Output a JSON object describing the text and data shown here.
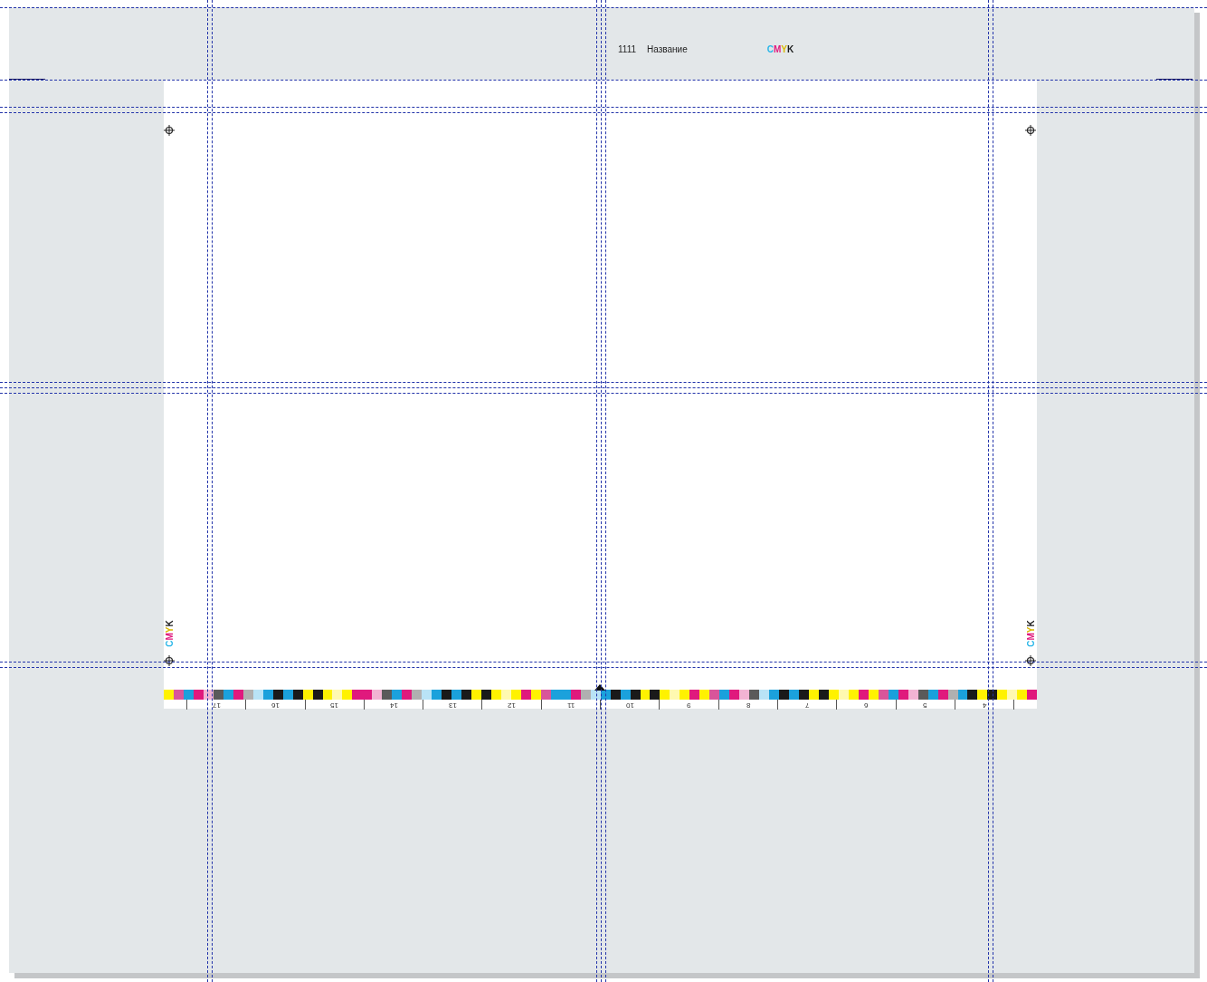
{
  "header": {
    "number": "1111",
    "title": "Название",
    "cmyk": [
      {
        "letter": "C",
        "color": "#29b6e8"
      },
      {
        "letter": "M",
        "color": "#e0197d"
      },
      {
        "letter": "Y",
        "color": "#d9b800"
      },
      {
        "letter": "K",
        "color": "#1a1a1a"
      }
    ]
  },
  "left_cmyk": [
    {
      "letter": "C",
      "color": "#29b6e8"
    },
    {
      "letter": "M",
      "color": "#e0197d"
    },
    {
      "letter": "Y",
      "color": "#d9b800"
    },
    {
      "letter": "K",
      "color": "#1a1a1a"
    }
  ],
  "right_cmyk": [
    {
      "letter": "C",
      "color": "#29b6e8"
    },
    {
      "letter": "M",
      "color": "#e0197d"
    },
    {
      "letter": "Y",
      "color": "#d9b800"
    },
    {
      "letter": "K",
      "color": "#1a1a1a"
    }
  ],
  "scale_labels": [
    "17",
    "16",
    "15",
    "14",
    "13",
    "12",
    "11",
    "10",
    "9",
    "8",
    "7",
    "6",
    "5",
    "4"
  ]
}
